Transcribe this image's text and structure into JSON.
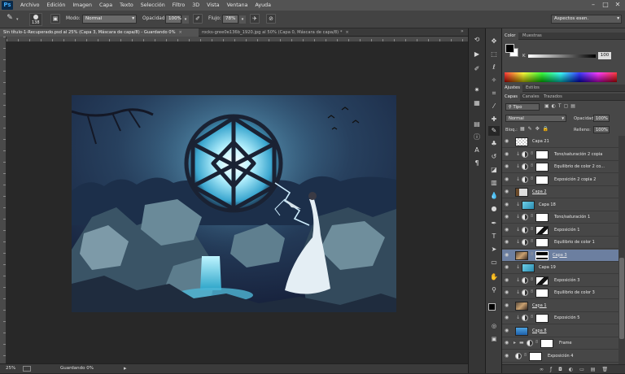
{
  "app": {
    "logo": "Ps",
    "menu": [
      "Archivo",
      "Edición",
      "Imagen",
      "Capa",
      "Texto",
      "Selección",
      "Filtro",
      "3D",
      "Vista",
      "Ventana",
      "Ayuda"
    ]
  },
  "options_bar": {
    "brush_size": "138",
    "mode_label": "Modo:",
    "mode_value": "Normal",
    "opacity_label": "Opacidad:",
    "opacity_value": "100%",
    "flow_label": "Flujo:",
    "flow_value": "78%",
    "workspace": "Aspectos esen."
  },
  "tabs": [
    {
      "label": "Sin título-1-Recuperado.psd al 25% (Capa 3, Máscara de capa/8) - Guardando 0%",
      "active": true
    },
    {
      "label": "rocks-gree0e136b_1920.jpg al 50% (Capa 0, Máscara de capa/8) *",
      "active": false
    }
  ],
  "status": {
    "zoom": "25%",
    "saving": "Guardando 0%"
  },
  "panels": {
    "color_tabs": [
      "Color",
      "Muestras"
    ],
    "color_k_label": "K",
    "color_k_value": "100",
    "adjust_tabs": [
      "Ajustes",
      "Estilos"
    ],
    "layers_tabs": [
      "Capas",
      "Canales",
      "Trazados"
    ],
    "filter_kind": "Tipo",
    "blend_mode": "Normal",
    "opacity_label": "Opacidad:",
    "opacity_value": "100%",
    "lock_label": "Bloq.:",
    "fill_label": "Relleno:",
    "fill_value": "100%"
  },
  "layers": [
    {
      "name": "Capa 21",
      "kind": "checker"
    },
    {
      "name": "Tono/saturación 2 copia",
      "kind": "adj",
      "clip": true
    },
    {
      "name": "Equilibrio de color 2 co...",
      "kind": "adj",
      "clip": true
    },
    {
      "name": "Exposición 2 copia 2",
      "kind": "adj",
      "clip": true
    },
    {
      "name": "Capa 2",
      "kind": "photo-checker",
      "underline": true
    },
    {
      "name": "Capa 18",
      "kind": "cyan",
      "clip": true
    },
    {
      "name": "Tono/saturación 1",
      "kind": "adj",
      "clip": true
    },
    {
      "name": "Exposición 1",
      "kind": "adj-dark",
      "clip": true
    },
    {
      "name": "Equilibrio de color 1",
      "kind": "adj",
      "clip": true
    },
    {
      "name": "Capa 3",
      "kind": "photo-mask",
      "underline": true,
      "selected": true
    },
    {
      "name": "Capa 19",
      "kind": "cyan",
      "clip": true
    },
    {
      "name": "Exposición 3",
      "kind": "adj-dark",
      "clip": true
    },
    {
      "name": "Equilibrio de color 3",
      "kind": "adj",
      "clip": true
    },
    {
      "name": "Capa 1",
      "kind": "photo",
      "underline": true
    },
    {
      "name": "Exposición 5",
      "kind": "adj",
      "clip": true
    },
    {
      "name": "Capa 8",
      "kind": "sky",
      "underline": true
    },
    {
      "name": "Frame",
      "kind": "folder"
    },
    {
      "name": "Exposición 4",
      "kind": "adj"
    }
  ]
}
